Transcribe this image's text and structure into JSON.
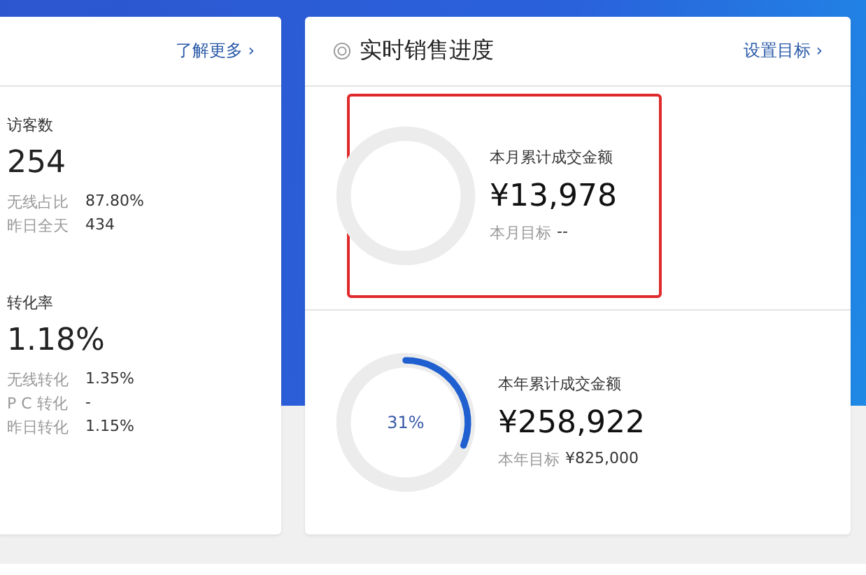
{
  "left_card": {
    "link": "了解更多 ›",
    "metrics": [
      {
        "title": "访客数",
        "value": "254",
        "details": [
          {
            "label": "无线占比",
            "value": "87.80%"
          },
          {
            "label": "昨日全天",
            "value": "434"
          }
        ]
      },
      {
        "title": "转化率",
        "value": "1.18%",
        "details": [
          {
            "label": "无线转化",
            "value": "1.35%"
          },
          {
            "label": "P C 转化",
            "value": "-"
          },
          {
            "label": "昨日转化",
            "value": "1.15%"
          }
        ]
      }
    ]
  },
  "sales_card": {
    "title": "实时销售进度",
    "link": "设置目标 ›",
    "sections": [
      {
        "label": "本月累计成交金额",
        "amount": "¥13,978",
        "target_label": "本月目标",
        "target": "--",
        "highlighted": true
      },
      {
        "label": "本年累计成交金额",
        "amount": "¥258,922",
        "target_label": "本年目标",
        "target": "¥825,000",
        "percent": "31%",
        "highlighted": false
      }
    ]
  }
}
